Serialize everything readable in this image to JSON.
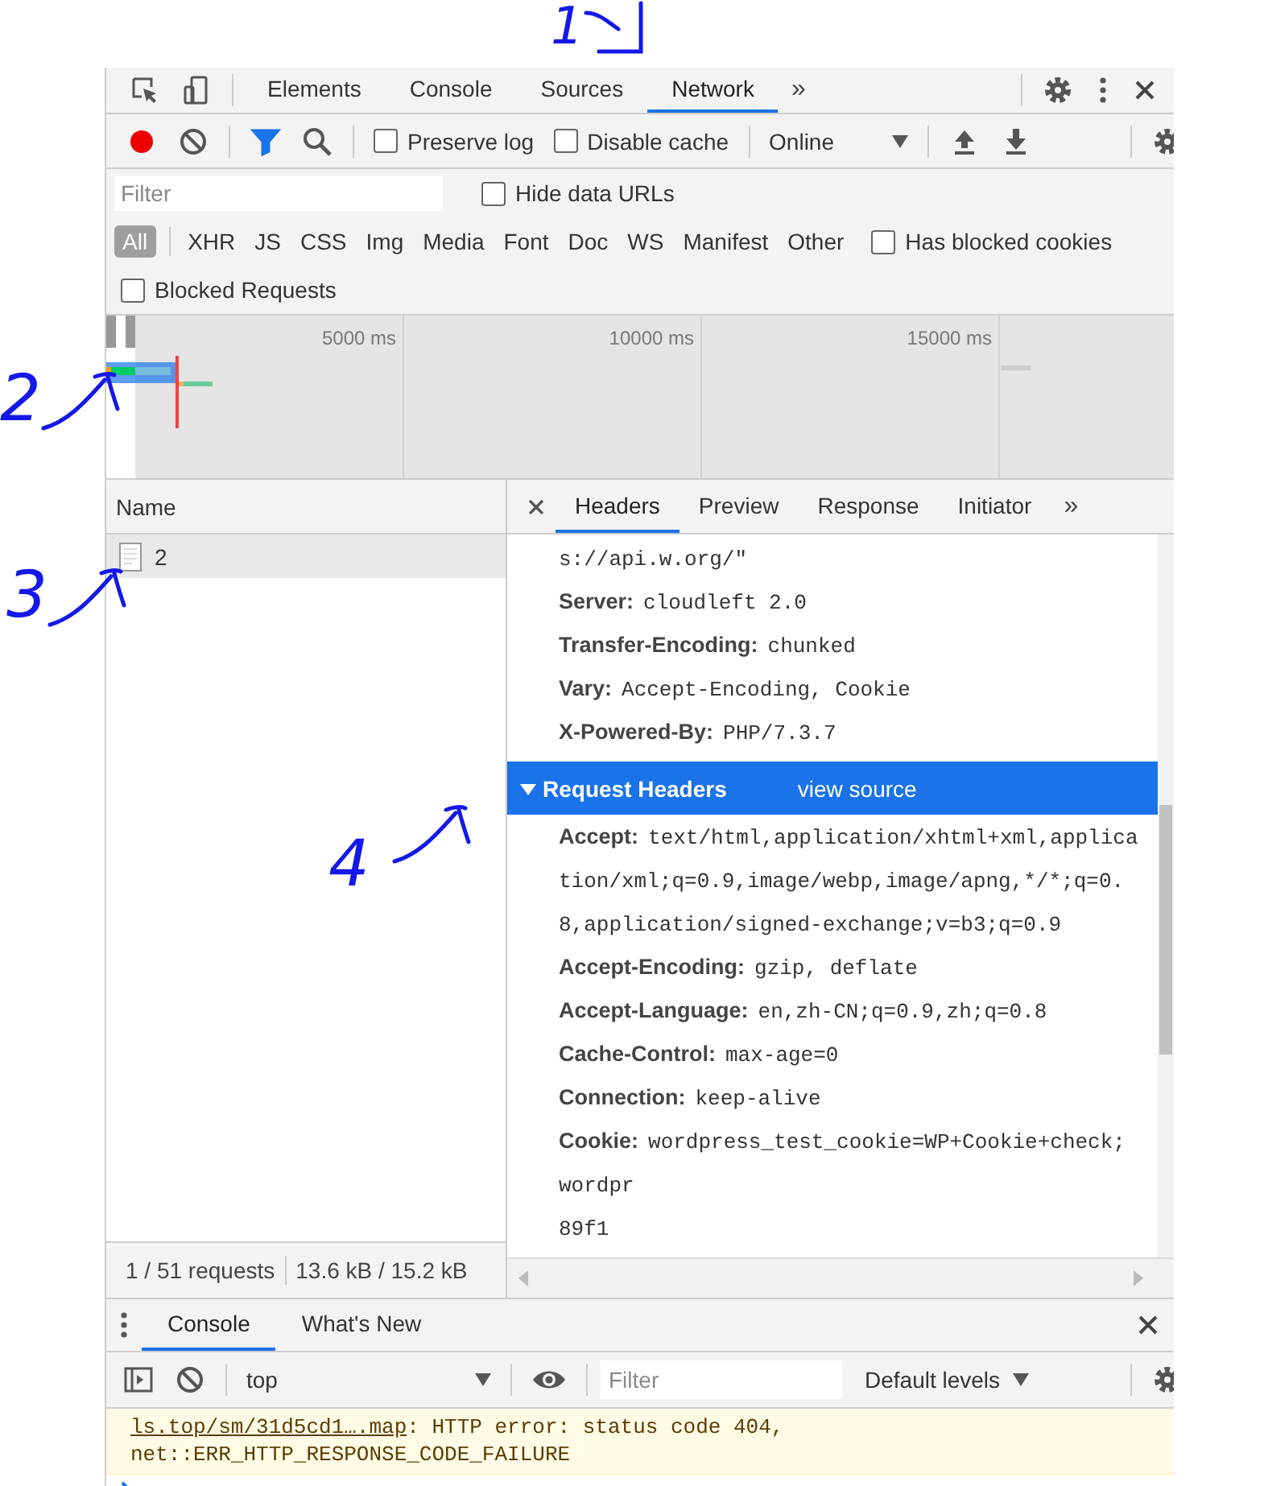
{
  "annotations": [
    {
      "label": "1"
    },
    {
      "label": "2"
    },
    {
      "label": "3"
    },
    {
      "label": "4"
    }
  ],
  "main_tabs": [
    {
      "label": "Elements",
      "selected": false
    },
    {
      "label": "Console",
      "selected": false
    },
    {
      "label": "Sources",
      "selected": false
    },
    {
      "label": "Network",
      "selected": true
    }
  ],
  "main_tabs_overflow": "»",
  "toolbar": {
    "recording": true,
    "filter_active": true,
    "preserve_log": {
      "label": "Preserve log",
      "checked": false
    },
    "disable_cache": {
      "label": "Disable cache",
      "checked": false
    },
    "throttling": "Online"
  },
  "filter": {
    "placeholder": "Filter",
    "hide_data_urls": {
      "label": "Hide data URLs",
      "checked": false
    }
  },
  "type_filters": [
    {
      "label": "All",
      "selected": true
    },
    {
      "label": "XHR",
      "selected": false
    },
    {
      "label": "JS",
      "selected": false
    },
    {
      "label": "CSS",
      "selected": false
    },
    {
      "label": "Img",
      "selected": false
    },
    {
      "label": "Media",
      "selected": false
    },
    {
      "label": "Font",
      "selected": false
    },
    {
      "label": "Doc",
      "selected": false
    },
    {
      "label": "WS",
      "selected": false
    },
    {
      "label": "Manifest",
      "selected": false
    },
    {
      "label": "Other",
      "selected": false
    }
  ],
  "has_blocked_cookies": {
    "label": "Has blocked cookies",
    "checked": false
  },
  "blocked_requests": {
    "label": "Blocked Requests",
    "checked": false
  },
  "overview": {
    "ticks": [
      "5000 ms",
      "10000 ms",
      "15000 ms"
    ]
  },
  "requests": {
    "column": "Name",
    "rows": [
      {
        "name": "2",
        "selected": true
      }
    ]
  },
  "detail_tabs": [
    {
      "label": "Headers",
      "selected": true
    },
    {
      "label": "Preview",
      "selected": false
    },
    {
      "label": "Response",
      "selected": false
    },
    {
      "label": "Initiator",
      "selected": false
    }
  ],
  "detail_tabs_overflow": "»",
  "response_headers": [
    {
      "kind": "continuation",
      "value": "s://api.w.org/\""
    },
    {
      "kind": "header",
      "name": "Server:",
      "value": "cloudleft 2.0"
    },
    {
      "kind": "header",
      "name": "Transfer-Encoding:",
      "value": "chunked"
    },
    {
      "kind": "header",
      "name": "Vary:",
      "value": "Accept-Encoding, Cookie"
    },
    {
      "kind": "header",
      "name": "X-Powered-By:",
      "value": "PHP/7.3.7"
    }
  ],
  "request_headers": {
    "title": "Request Headers",
    "expanded": true,
    "link": "view source",
    "items": [
      {
        "kind": "header",
        "name": "Accept:",
        "value": "text/html,application/xhtml+xml,application/xml;q=0.9,image/webp,image/apng,*/*;q=0.8,application/signed-exchange;v=b3;q=0.9"
      },
      {
        "kind": "header",
        "name": "Accept-Encoding:",
        "value": "gzip, deflate"
      },
      {
        "kind": "header",
        "name": "Accept-Language:",
        "value": "en,zh-CN;q=0.9,zh;q=0.8"
      },
      {
        "kind": "header",
        "name": "Cache-Control:",
        "value": "max-age=0"
      },
      {
        "kind": "header",
        "name": "Connection:",
        "value": "keep-alive"
      },
      {
        "kind": "header",
        "name": "Cookie:",
        "value": "wordpress_test_cookie=WP+Cookie+check; wordpr"
      },
      {
        "kind": "continuation",
        "value": "89f1"
      }
    ]
  },
  "status": {
    "requests": "1 / 51 requests",
    "transferred": "13.6 kB / 15.2 kB"
  },
  "drawer_tabs": [
    {
      "label": "Console",
      "selected": true
    },
    {
      "label": "What's New",
      "selected": false
    }
  ],
  "console_toolbar": {
    "context": "top",
    "filter_placeholder": "Filter",
    "levels": "Default levels"
  },
  "messages": [
    {
      "link": "ls.top/sm/31d5cd1….map",
      "text": ": HTTP error: status code 404,",
      "continuation": "net::ERR_HTTP_RESPONSE_CODE_FAILURE"
    }
  ]
}
